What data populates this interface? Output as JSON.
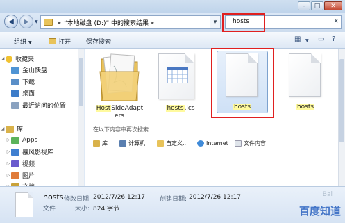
{
  "address": {
    "path": "“本地磁盘 (D:)” 中的搜索结果"
  },
  "search": {
    "value": "hosts"
  },
  "toolbar": {
    "organize": "组织",
    "open": "打开",
    "save_search": "保存搜索"
  },
  "nav": {
    "favorites": "收藏夹",
    "items": [
      "金山快盘",
      "下载",
      "桌面",
      "最近访问的位置"
    ],
    "library": "库",
    "lib_items": [
      "Apps",
      "暴风影视库",
      "视频",
      "图片",
      "文档"
    ]
  },
  "files": [
    {
      "name": "HostSideAdapters",
      "highlight": "Host"
    },
    {
      "name": "hosts.ics",
      "highlight": "hosts"
    },
    {
      "name": "hosts",
      "highlight": "hosts"
    },
    {
      "name": "hosts",
      "highlight": "hosts"
    }
  ],
  "search_again": {
    "label": "在以下内容中再次搜索:",
    "targets": [
      "库",
      "计算机",
      "自定义...",
      "Internet",
      "文件内容"
    ]
  },
  "details": {
    "name": "hosts",
    "modified_label": "修改日期:",
    "modified": "2012/7/26 12:17",
    "created_label": "创建日期:",
    "created": "2012/7/26 12:17",
    "type": "文件",
    "size_label": "大小:",
    "size": "824 字节"
  },
  "watermark": "百度知道"
}
